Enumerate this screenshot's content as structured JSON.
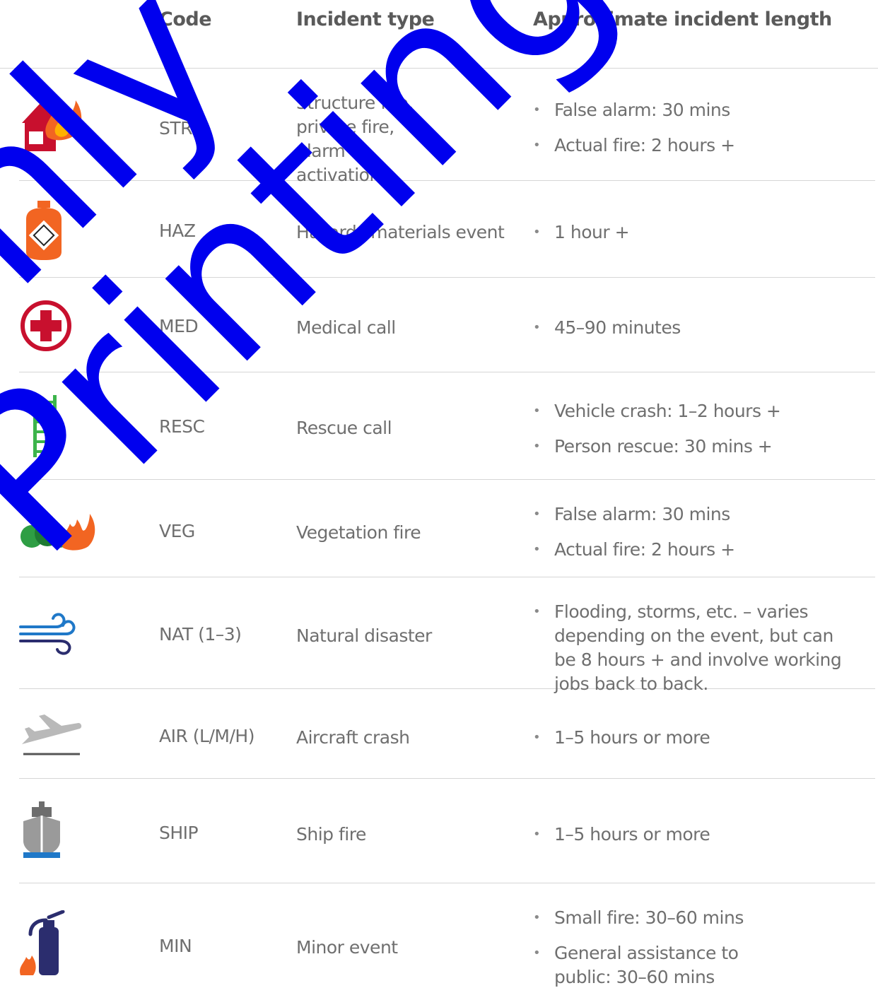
{
  "header": {
    "code": "Code",
    "type": "Incident type",
    "length": "Approximate incident length"
  },
  "rows": [
    {
      "icon": "house-fire-icon",
      "code": "STRU",
      "type": "Structure fire, private fire, alarm activation",
      "lengths": [
        "False alarm: 30 mins",
        "Actual fire: 2 hours +"
      ]
    },
    {
      "icon": "hazmat-canister-icon",
      "code": "HAZ",
      "type": "Hazards materials event",
      "lengths": [
        "1 hour +"
      ]
    },
    {
      "icon": "medical-cross-icon",
      "code": "MED",
      "type": "Medical call",
      "lengths": [
        "45–90 minutes"
      ]
    },
    {
      "icon": "ladder-icon",
      "code": "RESC",
      "type": "Rescue call",
      "lengths": [
        "Vehicle crash: 1–2 hours +",
        "Person rescue: 30 mins +"
      ]
    },
    {
      "icon": "bush-fire-icon",
      "code": "VEG",
      "type": "Vegetation fire",
      "lengths": [
        "False alarm: 30 mins",
        "Actual fire: 2 hours +"
      ]
    },
    {
      "icon": "wind-icon",
      "code": "NAT (1–3)",
      "type": "Natural disaster",
      "lengths": [
        "Flooding, storms, etc. – varies depending on the event, but can be 8 hours + and involve working jobs back to back."
      ]
    },
    {
      "icon": "airplane-icon",
      "code": "AIR (L/M/H)",
      "type": "Aircraft crash",
      "lengths": [
        "1–5 hours or more"
      ]
    },
    {
      "icon": "ship-icon",
      "code": "SHIP",
      "type": "Ship fire",
      "lengths": [
        "1–5 hours or more"
      ]
    },
    {
      "icon": "fire-extinguisher-icon",
      "code": "MIN",
      "type": "Minor event",
      "lengths": [
        "Small fire: 30–60 mins",
        "General assistance to public: 30–60 mins"
      ]
    }
  ],
  "watermark": {
    "line1": "nly",
    "line2": "Printing",
    "color": "#0000ee"
  },
  "colors": {
    "fire_red": "#c8102e",
    "fire_orange": "#f26522",
    "ladder_green": "#3cb44b",
    "bush_green": "#2e9e44",
    "wind_blue": "#1f78c8",
    "navy": "#2b2d6e",
    "plane_grey": "#b9b9b9"
  }
}
